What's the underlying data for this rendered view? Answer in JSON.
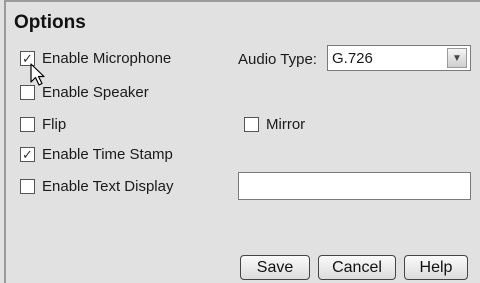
{
  "panel": {
    "title": "Options"
  },
  "options": {
    "enable_microphone": {
      "label": "Enable Microphone",
      "checked": true
    },
    "enable_speaker": {
      "label": "Enable Speaker",
      "checked": false
    },
    "flip": {
      "label": "Flip",
      "checked": false
    },
    "mirror": {
      "label": "Mirror",
      "checked": false
    },
    "enable_time_stamp": {
      "label": "Enable Time Stamp",
      "checked": true
    },
    "enable_text_display": {
      "label": "Enable Text Display",
      "checked": false
    }
  },
  "audio_type": {
    "label": "Audio Type:",
    "selected": "G.726"
  },
  "text_display": {
    "value": ""
  },
  "buttons": {
    "save": "Save",
    "cancel": "Cancel",
    "help": "Help"
  },
  "icons": {
    "checkmark": "check-icon",
    "dropdown": "chevron-down-icon",
    "cursor": "arrow-cursor-icon"
  }
}
